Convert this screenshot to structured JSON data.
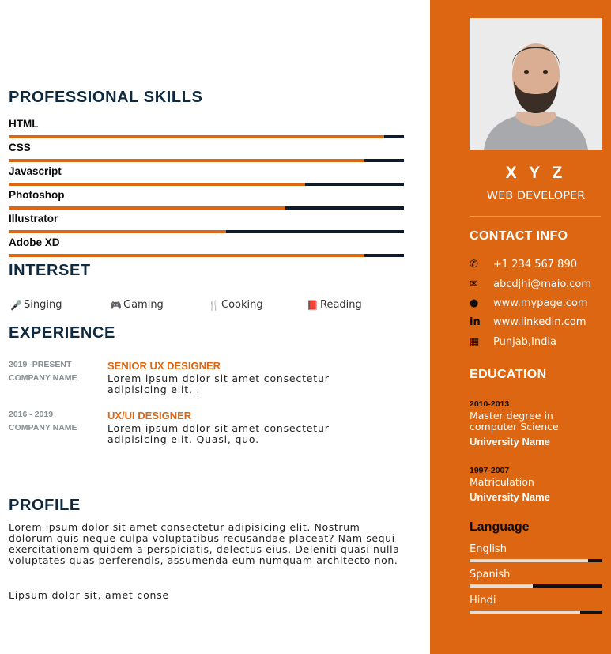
{
  "colors": {
    "accent": "#dc6611",
    "dark": "#0f2a3f"
  },
  "skills": {
    "title": "PROFESSIONAL SKILLS",
    "items": [
      {
        "name": "HTML",
        "level": 0.95
      },
      {
        "name": "CSS",
        "level": 0.9
      },
      {
        "name": "Javascript",
        "level": 0.75
      },
      {
        "name": "Photoshop",
        "level": 0.7
      },
      {
        "name": "Illustrator",
        "level": 0.55
      },
      {
        "name": "Adobe XD",
        "level": 0.9
      }
    ]
  },
  "interests": {
    "title": "INTERSET",
    "items": [
      {
        "label": "Singing",
        "icon": "microphone-icon"
      },
      {
        "label": "Gaming",
        "icon": "gamepad-icon"
      },
      {
        "label": "Cooking",
        "icon": "utensils-icon"
      },
      {
        "label": "Reading",
        "icon": "book-icon"
      }
    ]
  },
  "experience": {
    "title": "EXPERIENCE",
    "items": [
      {
        "date": "2019 -PRESENT",
        "company": "COMPANY NAME",
        "role": "SENIOR UX DESIGNER",
        "desc": "Lorem ipsum dolor sit amet consectetur adipisicing elit. ."
      },
      {
        "date": "2016 - 2019",
        "company": "COMPANY NAME",
        "role": "UX/UI DESIGNER",
        "desc": "Lorem ipsum dolor sit amet consectetur adipisicing elit. Quasi, quo."
      }
    ]
  },
  "profile": {
    "title": "PROFILE",
    "text": "Lorem ipsum dolor sit amet consectetur adipisicing elit. Nostrum dolorum quis neque culpa voluptatibus recusandae placeat? Nam sequi exercitationem quidem a perspiciatis, delectus eius. Deleniti quasi nulla voluptates quas perferendis, assumenda eum numquam architecto non.",
    "text2": "Lipsum dolor sit, amet conse"
  },
  "sidebar": {
    "name": "X Y Z",
    "job_title": "WEB DEVELOPER",
    "contact": {
      "title": "CONTACT INFO",
      "items": [
        {
          "icon": "phone-icon",
          "text": "+1 234 567 890"
        },
        {
          "icon": "envelope-icon",
          "text": "abcdjhi@maio.com"
        },
        {
          "icon": "globe-icon",
          "text": "www.mypage.com"
        },
        {
          "icon": "linkedin-icon",
          "text": "www.linkedin.com"
        },
        {
          "icon": "map-icon",
          "text": "Punjab,India"
        }
      ]
    },
    "education": {
      "title": "EDUCATION",
      "items": [
        {
          "years": "2010-2013",
          "degree": "Master degree in computer Science",
          "school": "University Name"
        },
        {
          "years": "1997-2007",
          "degree": "Matriculation",
          "school": "University Name"
        }
      ]
    },
    "language": {
      "title": "Language",
      "items": [
        {
          "name": "English",
          "level": 0.9
        },
        {
          "name": "Spanish",
          "level": 0.48
        },
        {
          "name": "Hindi",
          "level": 0.84
        }
      ]
    }
  }
}
